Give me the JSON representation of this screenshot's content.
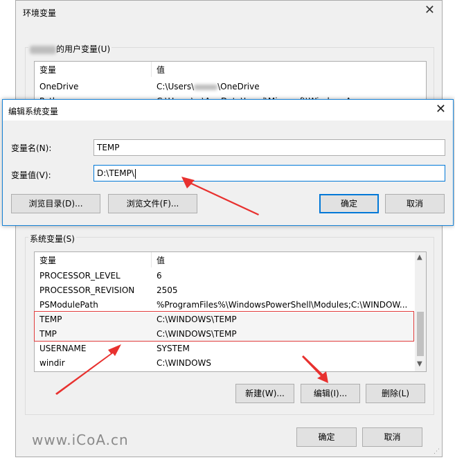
{
  "background_dialog": {
    "title": "环境变量",
    "user_group_label": "的用户变量(U)",
    "user_table": {
      "headers": [
        "变量",
        "值"
      ],
      "rows": [
        {
          "name": "OneDrive",
          "value_prefix": "C:\\Users\\",
          "value_suffix": "\\OneDrive"
        },
        {
          "name": "Path",
          "value": "C:\\Users\\...\\AppData\\Local\\Microsoft\\WindowsApps"
        }
      ]
    },
    "system_group_label": "系统变量(S)",
    "system_table": {
      "headers": [
        "变量",
        "值"
      ],
      "rows": [
        {
          "name": "PROCESSOR_LEVEL",
          "value": "6"
        },
        {
          "name": "PROCESSOR_REVISION",
          "value": "2505"
        },
        {
          "name": "PSModulePath",
          "value": "%ProgramFiles%\\WindowsPowerShell\\Modules;C:\\WINDOW..."
        },
        {
          "name": "TEMP",
          "value": "C:\\WINDOWS\\TEMP"
        },
        {
          "name": "TMP",
          "value": "C:\\WINDOWS\\TEMP"
        },
        {
          "name": "USERNAME",
          "value": "SYSTEM"
        },
        {
          "name": "windir",
          "value": "C:\\WINDOWS"
        }
      ]
    },
    "system_buttons": {
      "new": "新建(W)...",
      "edit": "编辑(I)...",
      "delete": "删除(L)"
    },
    "ok": "确定",
    "cancel": "取消"
  },
  "edit_dialog": {
    "title": "编辑系统变量",
    "name_label": "变量名(N):",
    "name_value": "TEMP",
    "value_label": "变量值(V):",
    "value_value": "D:\\TEMP\\",
    "browse_dir": "浏览目录(D)...",
    "browse_file": "浏览文件(F)...",
    "ok": "确定",
    "cancel": "取消"
  },
  "watermark": "www.iCoA.cn",
  "colors": {
    "accent": "#0078d7",
    "highlight_box": "#e03c3c",
    "arrow": "#e8312f"
  }
}
